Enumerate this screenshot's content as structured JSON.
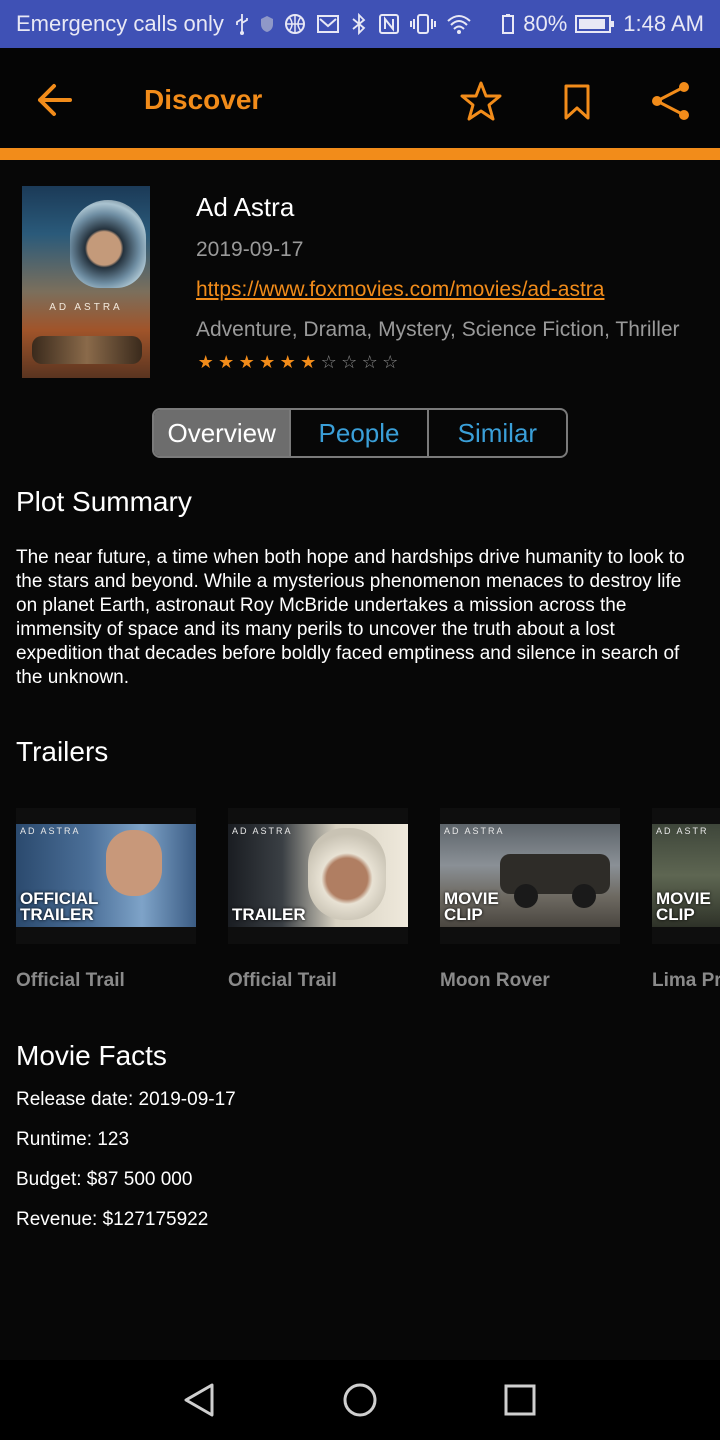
{
  "status_bar": {
    "left_text": "Emergency calls only",
    "battery": "80%",
    "time": "1:48 AM"
  },
  "app_bar": {
    "title": "Discover",
    "accent_color": "#f28c1a"
  },
  "movie": {
    "poster_title": "AD ASTRA",
    "title": "Ad Astra",
    "release_date": "2019-09-17",
    "url": "https://www.foxmovies.com/movies/ad-astra",
    "genres": "Adventure, Drama, Mystery, Science Fiction, Thriller",
    "rating": 6,
    "rating_max": 10
  },
  "tabs": [
    {
      "label": "Overview",
      "active": true
    },
    {
      "label": "People",
      "active": false
    },
    {
      "label": "Similar",
      "active": false
    }
  ],
  "plot": {
    "heading": "Plot Summary",
    "text": "The near future, a time when both hope and hardships drive humanity to look to the stars and beyond. While a mysterious phenomenon menaces to destroy life on planet Earth, astronaut Roy McBride undertakes a mission across the immensity of space and its many perils to uncover the truth about a lost expedition that decades before boldly faced emptiness and silence in search of the unknown."
  },
  "trailers": {
    "heading": "Trailers",
    "items": [
      {
        "caption": "Official Trail",
        "thumb_brand": "AD ASTRA",
        "thumb_label": "OFFICIAL TRAILER"
      },
      {
        "caption": "Official Trail",
        "thumb_brand": "AD ASTRA",
        "thumb_label": "TRAILER"
      },
      {
        "caption": "Moon Rover",
        "thumb_brand": "AD ASTRA",
        "thumb_label": "MOVIE CLIP"
      },
      {
        "caption": "Lima Pr",
        "thumb_brand": "AD ASTR",
        "thumb_label": "MOVIE CLIP"
      }
    ]
  },
  "facts": {
    "heading": "Movie Facts",
    "release": "Release date: 2019-09-17",
    "runtime": "Runtime: 123",
    "budget": "Budget: $87 500 000",
    "revenue": "Revenue: $127175922"
  }
}
